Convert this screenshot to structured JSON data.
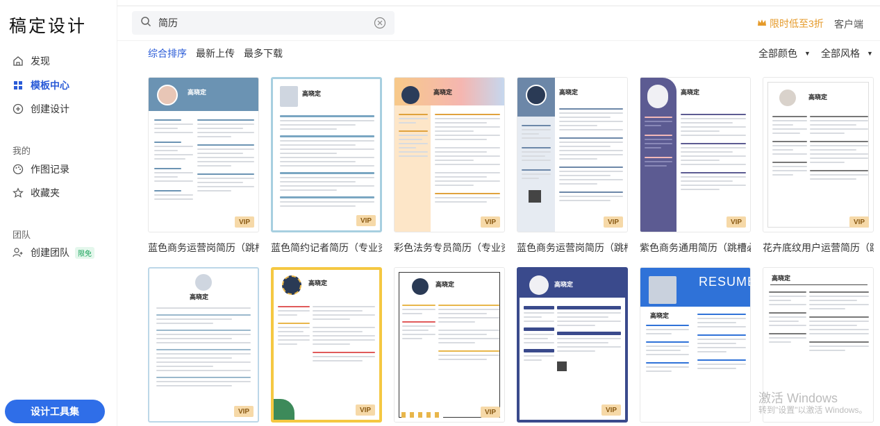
{
  "app": {
    "logo": "稿定设计"
  },
  "sidebar": {
    "items": [
      {
        "label": "发现"
      },
      {
        "label": "模板中心"
      },
      {
        "label": "创建设计"
      }
    ],
    "mine_label": "我的",
    "mine_items": [
      {
        "label": "作图记录"
      },
      {
        "label": "收藏夹"
      }
    ],
    "team_label": "团队",
    "team_item": {
      "label": "创建团队",
      "badge": "限免"
    },
    "tool_button": "设计工具集"
  },
  "header": {
    "search_value": "简历",
    "promo": "限时低至3折",
    "client": "客户端"
  },
  "sort_tabs": [
    "综合排序",
    "最新上传",
    "最多下载"
  ],
  "filters": {
    "color": "全部颜色",
    "style": "全部风格"
  },
  "vip_label": "VIP",
  "resume_name": "高晓定",
  "resume_word": "RESUME",
  "templates": [
    {
      "title": "蓝色商务运营岗简历（跳槽..."
    },
    {
      "title": "蓝色简约记者简历（专业资..."
    },
    {
      "title": "彩色法务专员简历（专业资..."
    },
    {
      "title": "蓝色商务运营岗简历（跳槽..."
    },
    {
      "title": "紫色商务通用简历（跳槽必..."
    },
    {
      "title": "花卉底纹用户运营简历（跳..."
    }
  ],
  "watermark": {
    "line1": "激活 Windows",
    "line2": "转到\"设置\"以激活 Windows。"
  },
  "colors": {
    "accent": "#2a5bd7",
    "tool_button": "#2f6ee8",
    "promo": "#e59a2a",
    "vip_bg": "#f6d9a8"
  }
}
